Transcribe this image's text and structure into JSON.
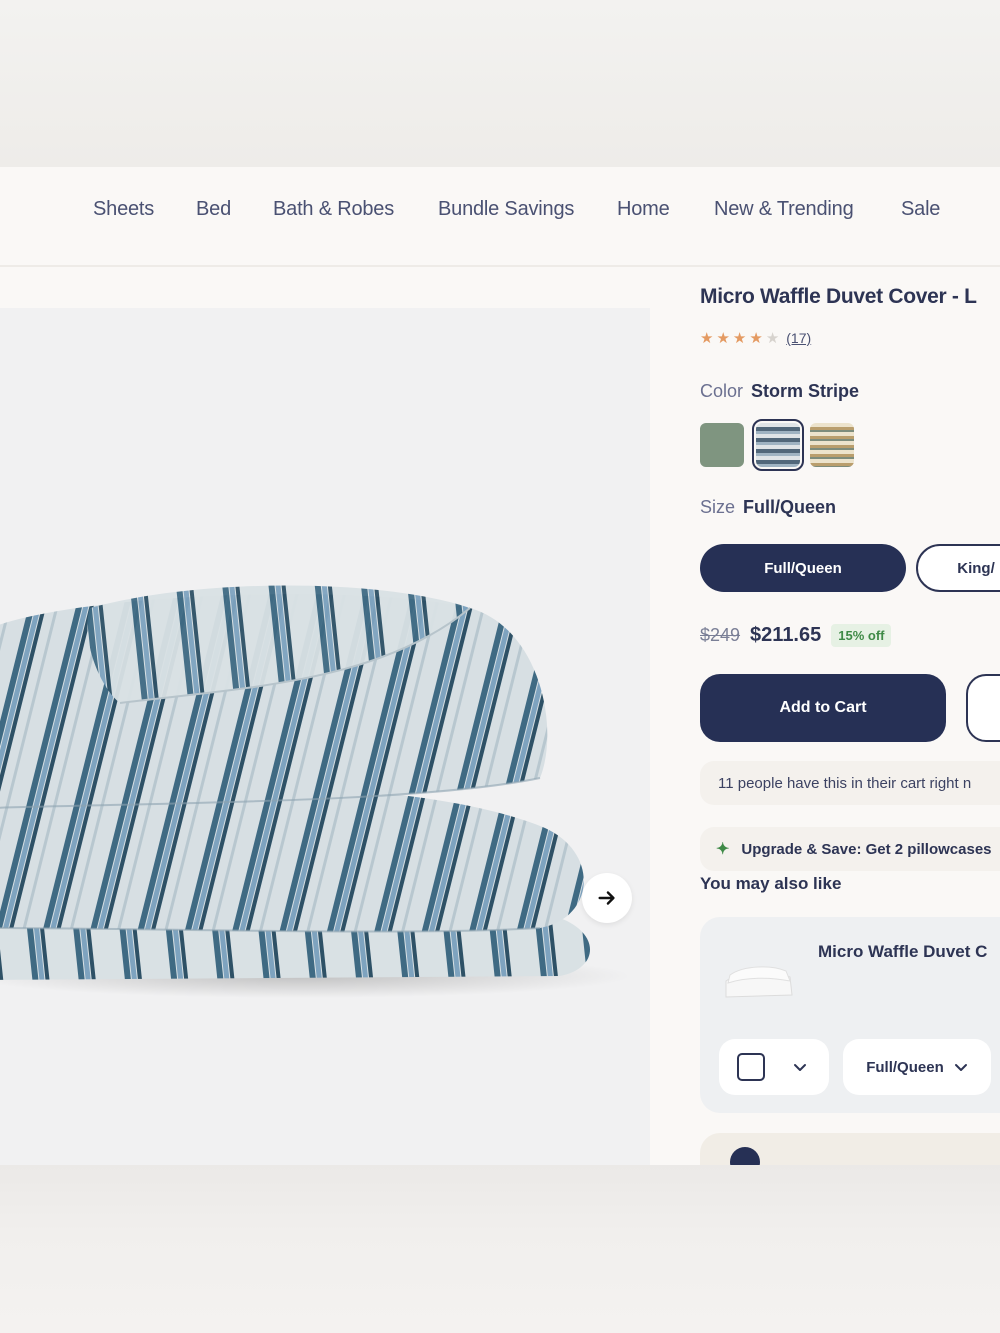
{
  "nav": {
    "items": [
      "Sheets",
      "Bed",
      "Bath & Robes",
      "Bundle Savings",
      "Home",
      "New & Trending",
      "Sale"
    ]
  },
  "product": {
    "title": "Micro Waffle Duvet Cover - L",
    "rating": 4,
    "rating_max": 5,
    "review_count": "(17)",
    "color_label": "Color",
    "color_value": "Storm Stripe",
    "swatches": [
      {
        "name": "sage",
        "color": "#7f9580"
      },
      {
        "name": "storm-stripe",
        "color": "#5f7183",
        "selected": true
      },
      {
        "name": "sand-stripe",
        "color": "#c9b48f"
      }
    ],
    "size_label": "Size",
    "size_value": "Full/Queen",
    "sizes": [
      "Full/Queen",
      "King/"
    ],
    "old_price": "$249",
    "price": "$211.65",
    "discount": "15% off",
    "add_to_cart": "Add to Cart",
    "cart_notice": "11 people have this in their cart right n",
    "upsell": "Upgrade & Save: Get 2 pillowcases"
  },
  "recommendations": {
    "title": "You may also like",
    "item_name": "Micro Waffle Duvet C",
    "size_select": "Full/Queen"
  },
  "colors": {
    "navy": "#263055",
    "accent_green": "#3f8a47",
    "star": "#e49a62"
  }
}
